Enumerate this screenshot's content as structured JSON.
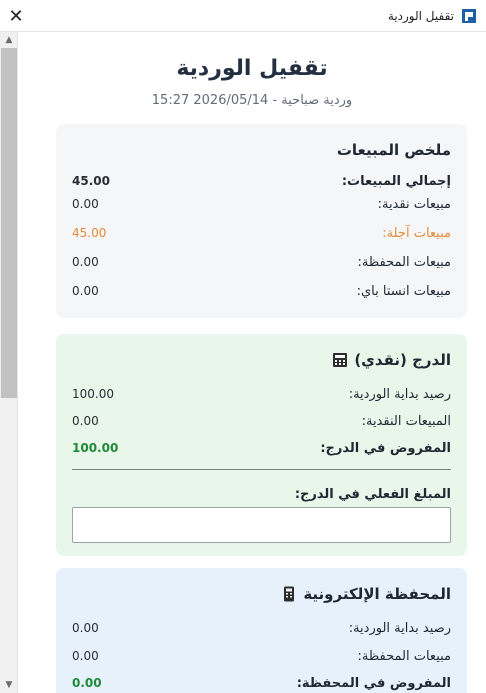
{
  "window": {
    "title": "تقفيل الوردية",
    "close_glyph": "✕"
  },
  "header": {
    "title": "تقفيل الوردية",
    "subtitle": "وردية صباحية - 2026/05/14 15:27"
  },
  "sales_summary": {
    "title": "ملخص المبيعات",
    "rows": [
      {
        "label": "إجمالي المبيعات:",
        "value": "45.00"
      },
      {
        "label": "مبيعات نقدية:",
        "value": "0.00"
      },
      {
        "label": "مبيعات آجلة:",
        "value": "45.00"
      },
      {
        "label": "مبيعات المحفظة:",
        "value": "0.00"
      },
      {
        "label": "مبيعات انستا باي:",
        "value": "0.00"
      }
    ]
  },
  "cash_drawer": {
    "title": "الدرج (نقدي)",
    "icon": "cash-register-icon",
    "rows": [
      {
        "label": "رصيد بداية الوردية:",
        "value": "100.00"
      },
      {
        "label": "المبيعات النقدية:",
        "value": "0.00"
      },
      {
        "label": "المفروض في الدرج:",
        "value": "100.00"
      }
    ],
    "actual_label": "المبلغ الفعلي في الدرج:",
    "actual_value": ""
  },
  "e_wallet": {
    "title": "المحفظة الإلكترونية",
    "icon": "mobile-wallet-icon",
    "rows": [
      {
        "label": "رصيد بداية الوردية:",
        "value": "0.00"
      },
      {
        "label": "مبيعات المحفظة:",
        "value": "0.00"
      },
      {
        "label": "المفروض في المحفظة:",
        "value": "0.00"
      }
    ]
  },
  "colors": {
    "accent_green": "#1e8a3a",
    "deferred_orange": "#e58a3a",
    "drawer_bg": "#e9f6ea",
    "wallet_bg": "#e6f1fb",
    "summary_bg": "#f5f6f8"
  }
}
